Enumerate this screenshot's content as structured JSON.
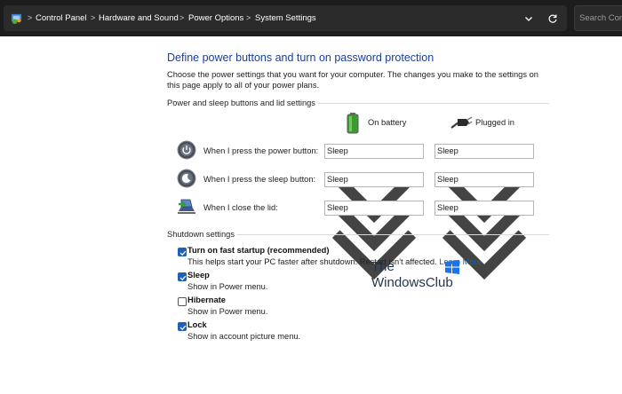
{
  "breadcrumb": [
    "Control Panel",
    "Hardware and Sound",
    "Power Options",
    "System Settings"
  ],
  "search": {
    "placeholder": "Search Con"
  },
  "page": {
    "title": "Define power buttons and turn on password protection",
    "description": "Choose the power settings that you want for your computer. The changes you make to the settings on this page apply to all of your power plans."
  },
  "power_group": {
    "label": "Power and sleep buttons and lid settings",
    "col_battery": "On battery",
    "col_plugged": "Plugged in",
    "rows": [
      {
        "label": "When I press the power button:",
        "battery": "Sleep",
        "plugged": "Sleep",
        "icon": "power-button-icon"
      },
      {
        "label": "When I press the sleep button:",
        "battery": "Sleep",
        "plugged": "Sleep",
        "icon": "sleep-button-icon"
      },
      {
        "label": "When I close the lid:",
        "battery": "Sleep",
        "plugged": "Sleep",
        "icon": "laptop-lid-icon"
      }
    ]
  },
  "shutdown_group": {
    "label": "Shutdown settings",
    "options": [
      {
        "title": "Turn on fast startup (recommended)",
        "checked": true,
        "desc": "This helps start your PC faster after shutdown. Restart isn't affected.",
        "link": "Learn More"
      },
      {
        "title": "Sleep",
        "checked": true,
        "desc": "Show in Power menu."
      },
      {
        "title": "Hibernate",
        "checked": false,
        "desc": "Show in Power menu."
      },
      {
        "title": "Lock",
        "checked": true,
        "desc": "Show in account picture menu."
      }
    ]
  },
  "watermark": {
    "line1": "The",
    "line2": "WindowsClub"
  },
  "colors": {
    "accent": "#1d60b5",
    "title": "#1a3e96",
    "topbar": "#1c1c1c"
  }
}
